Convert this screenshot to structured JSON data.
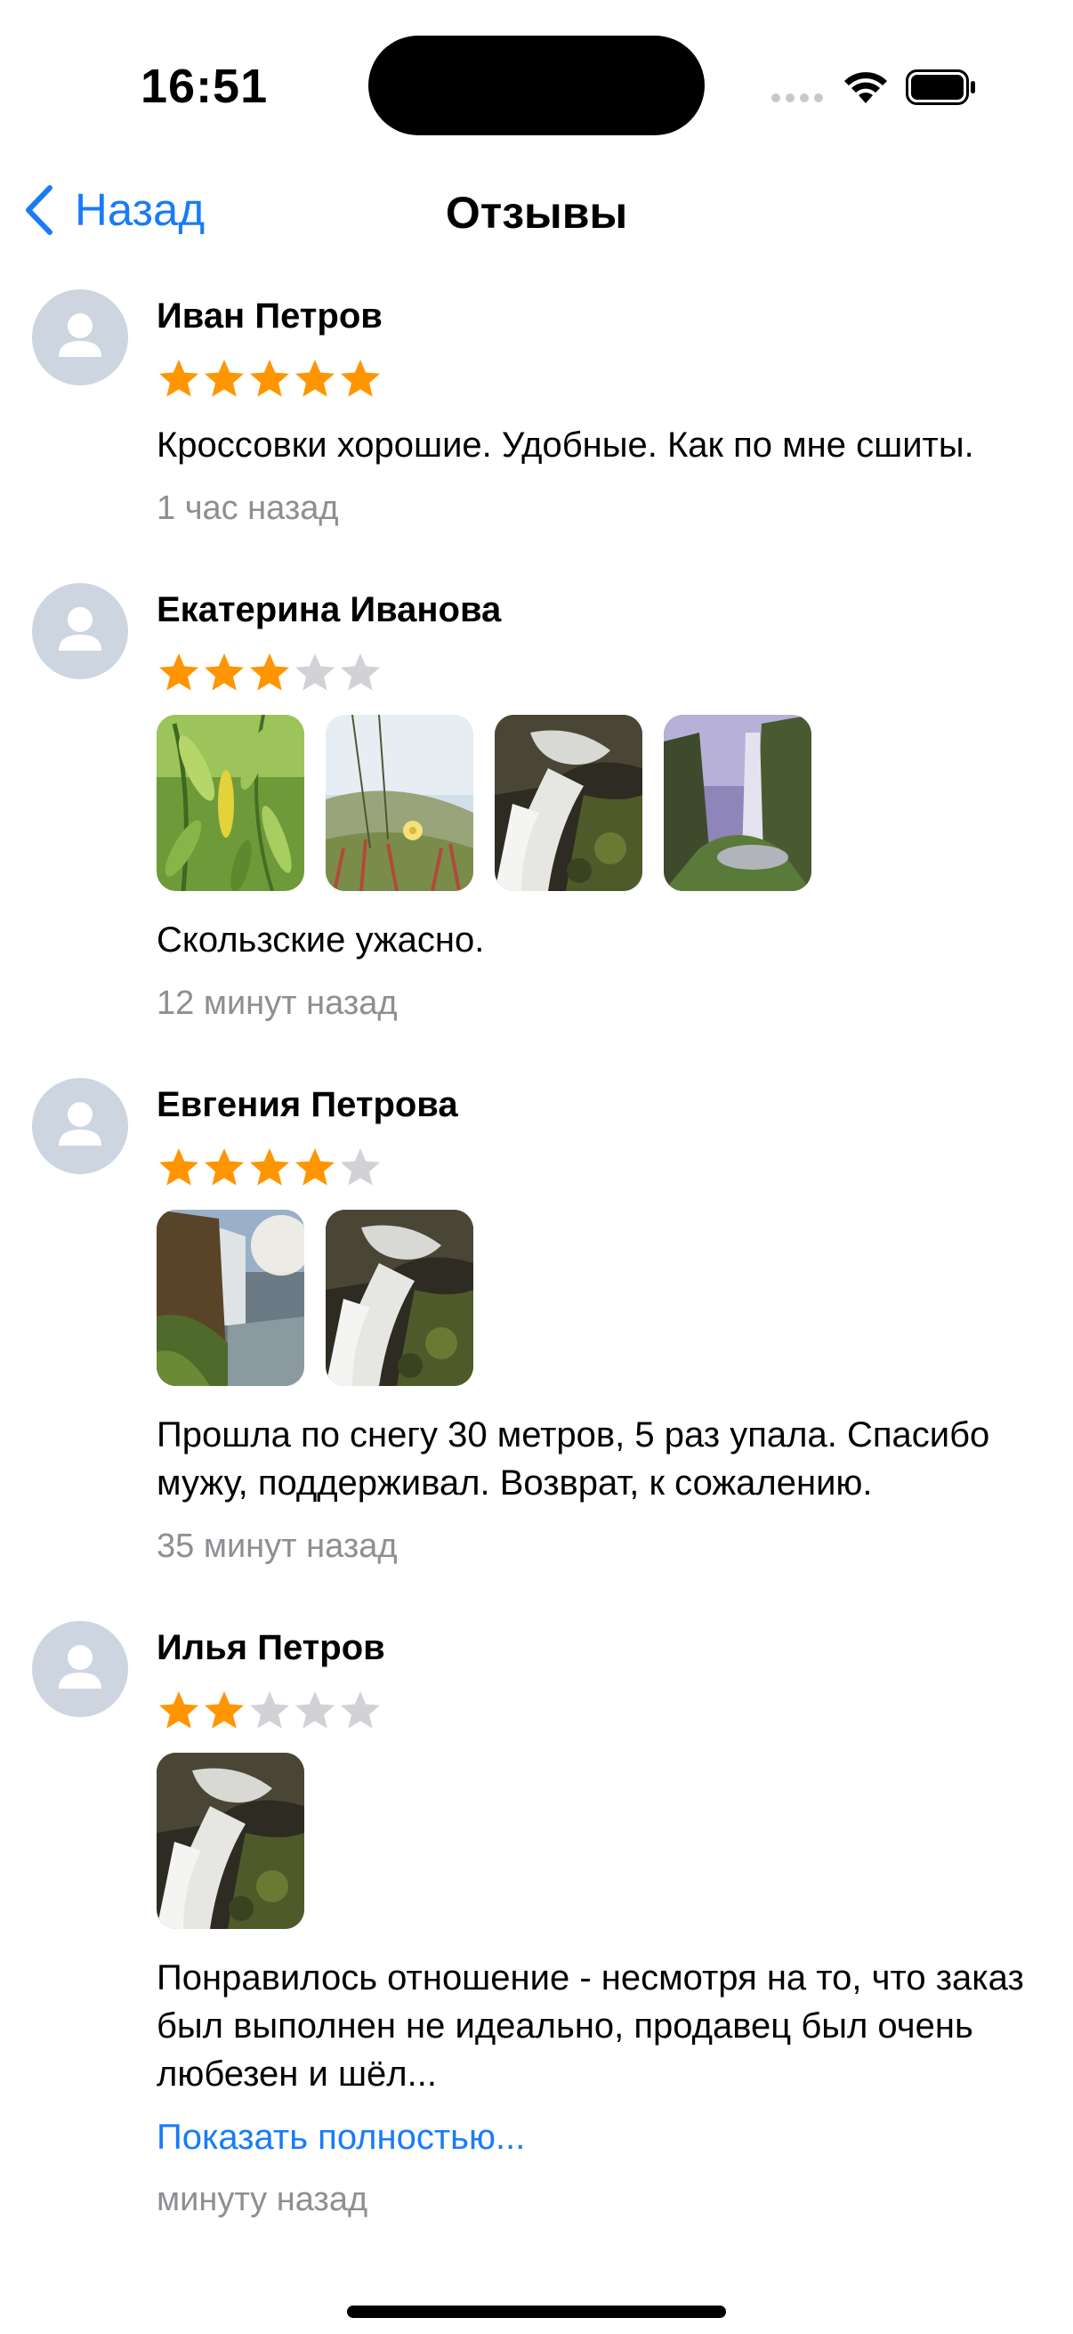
{
  "status_bar": {
    "time": "16:51"
  },
  "nav": {
    "back_label": "Назад",
    "title": "Отзывы"
  },
  "reviews": [
    {
      "name": "Иван Петров",
      "rating": 5,
      "photos": [],
      "text": "Кроссовки хорошие. Удобные. Как по мне сшиты.",
      "time": "1 час назад"
    },
    {
      "name": "Екатерина Иванова",
      "rating": 3,
      "photos": [
        "leaves-photo",
        "grass-flower-photo",
        "waterfall-rocks-photo",
        "waterfall-cliff-photo"
      ],
      "text": "Скользские ужасно.",
      "time": "12 минут назад"
    },
    {
      "name": "Евгения Петрова",
      "rating": 4,
      "photos": [
        "waterfall-lake-photo",
        "waterfall-rocks-photo"
      ],
      "text": "Прошла по снегу 30 метров, 5 раз упала. Спасибо мужу, поддерживал. Возврат, к сожалению.",
      "time": "35 минут назад"
    },
    {
      "name": "Илья Петров",
      "rating": 2,
      "photos": [
        "waterfall-rocks-photo"
      ],
      "text": "Понравилось отношение - несмотря на то, что заказ был выполнен не идеально, продавец был очень любезен и шёл...",
      "show_more": "Показать полностью...",
      "time": "минуту назад"
    }
  ],
  "colors": {
    "accent": "#1a7cf5",
    "star_filled": "#ff9500",
    "star_empty": "#d1d1d6",
    "avatar_bg": "#cdd5e0",
    "secondary_text": "#8e8e93"
  }
}
